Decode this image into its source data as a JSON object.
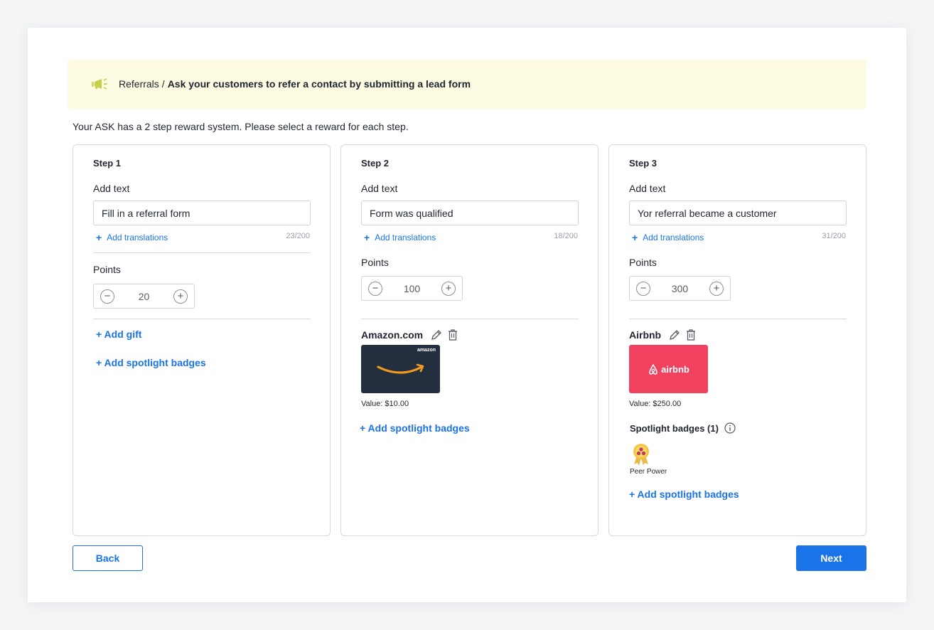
{
  "banner": {
    "crumb": "Referrals",
    "separator": "/",
    "title": "Ask your customers to refer a contact by submitting a lead form"
  },
  "intro": "Your ASK has a 2 step reward system. Please select a reward for each step.",
  "labels": {
    "add_text": "Add text",
    "add_translations": "Add translations",
    "points": "Points",
    "add_gift": "+ Add gift",
    "add_spotlight": "+ Add spotlight badges"
  },
  "steps": [
    {
      "title": "Step 1",
      "text": "Fill in a referral form",
      "count": "23/200",
      "points": "20"
    },
    {
      "title": "Step 2",
      "text": "Form was qualified",
      "count": "18/200",
      "points": "100",
      "gift": {
        "name": "Amazon.com",
        "brand_word": "amazon",
        "value": "Value: $10.00",
        "color": "#232f3e"
      }
    },
    {
      "title": "Step 3",
      "text": "Yor referral became a customer",
      "count": "31/200",
      "points": "300",
      "gift": {
        "name": "Airbnb",
        "brand_word": "airbnb",
        "value": "Value: $250.00",
        "color": "#f0415f"
      },
      "spotlight": {
        "title": "Spotlight badges (1)",
        "badge_label": "Peer Power"
      }
    }
  ],
  "buttons": {
    "back": "Back",
    "next": "Next"
  },
  "colors": {
    "accent": "#1a73e8",
    "banner_bg": "#fdfbe2"
  },
  "icons": [
    "megaphone-icon",
    "plus-icon",
    "minus-icon",
    "pencil-icon",
    "trash-icon",
    "info-icon",
    "badge-icon",
    "amazon-logo",
    "airbnb-logo"
  ]
}
